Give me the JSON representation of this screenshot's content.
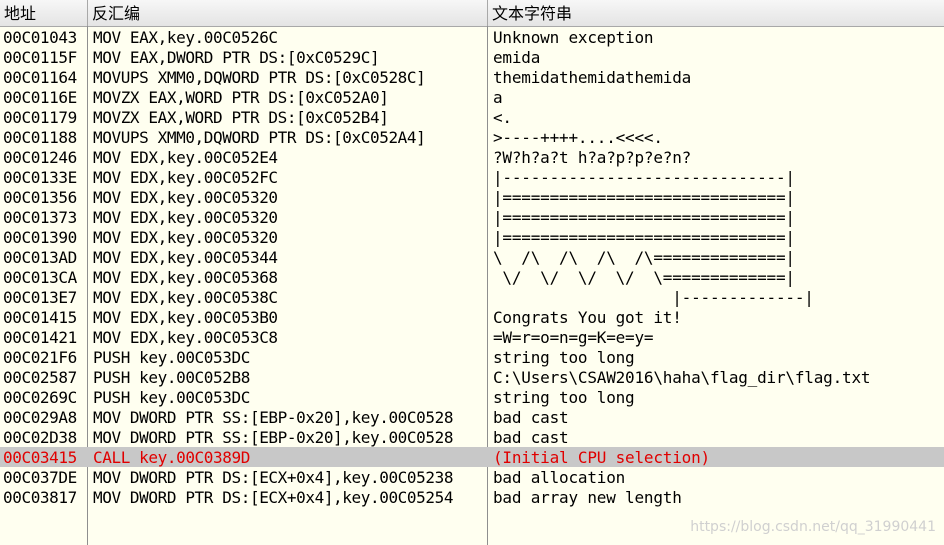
{
  "header": {
    "address": "地址",
    "disassembly": "反汇编",
    "text_string": "文本字符串"
  },
  "rows": [
    {
      "address": "00C01043",
      "disassembly": "MOV EAX,key.00C0526C",
      "text": "Unknown exception"
    },
    {
      "address": "00C0115F",
      "disassembly": "MOV EAX,DWORD PTR DS:[0xC0529C]",
      "text": "emida"
    },
    {
      "address": "00C01164",
      "disassembly": "MOVUPS XMM0,DQWORD PTR DS:[0xC0528C]",
      "text": "themidathemidathemida"
    },
    {
      "address": "00C0116E",
      "disassembly": "MOVZX EAX,WORD PTR DS:[0xC052A0]",
      "text": "a"
    },
    {
      "address": "00C01179",
      "disassembly": "MOVZX EAX,WORD PTR DS:[0xC052B4]",
      "text": "<."
    },
    {
      "address": "00C01188",
      "disassembly": "MOVUPS XMM0,DQWORD PTR DS:[0xC052A4]",
      "text": ">----++++....<<<<."
    },
    {
      "address": "00C01246",
      "disassembly": "MOV EDX,key.00C052E4",
      "text": "?W?h?a?t h?a?p?p?e?n?"
    },
    {
      "address": "00C0133E",
      "disassembly": "MOV EDX,key.00C052FC",
      "text": "|------------------------------|"
    },
    {
      "address": "00C01356",
      "disassembly": "MOV EDX,key.00C05320",
      "text": "|==============================|"
    },
    {
      "address": "00C01373",
      "disassembly": "MOV EDX,key.00C05320",
      "text": "|==============================|"
    },
    {
      "address": "00C01390",
      "disassembly": "MOV EDX,key.00C05320",
      "text": "|==============================|"
    },
    {
      "address": "00C013AD",
      "disassembly": "MOV EDX,key.00C05344",
      "text": "\\  /\\  /\\  /\\  /\\==============|"
    },
    {
      "address": "00C013CA",
      "disassembly": "MOV EDX,key.00C05368",
      "text": " \\/  \\/  \\/  \\/  \\=============|"
    },
    {
      "address": "00C013E7",
      "disassembly": "MOV EDX,key.00C0538C",
      "text": "                   |-------------|"
    },
    {
      "address": "00C01415",
      "disassembly": "MOV EDX,key.00C053B0",
      "text": "Congrats You got it!"
    },
    {
      "address": "00C01421",
      "disassembly": "MOV EDX,key.00C053C8",
      "text": "=W=r=o=n=g=K=e=y="
    },
    {
      "address": "00C021F6",
      "disassembly": "PUSH key.00C053DC",
      "text": "string too long"
    },
    {
      "address": "00C02587",
      "disassembly": "PUSH key.00C052B8",
      "text": "C:\\Users\\CSAW2016\\haha\\flag_dir\\flag.txt"
    },
    {
      "address": "00C0269C",
      "disassembly": "PUSH key.00C053DC",
      "text": "string too long"
    },
    {
      "address": "00C029A8",
      "disassembly": "MOV DWORD PTR SS:[EBP-0x20],key.00C0528",
      "text": "bad cast"
    },
    {
      "address": "00C02D38",
      "disassembly": "MOV DWORD PTR SS:[EBP-0x20],key.00C0528",
      "text": "bad cast"
    },
    {
      "address": "00C03415",
      "disassembly": "CALL key.00C0389D",
      "text": "(Initial CPU selection)",
      "selected": true
    },
    {
      "address": "00C037DE",
      "disassembly": "MOV DWORD PTR DS:[ECX+0x4],key.00C05238",
      "text": "bad allocation"
    },
    {
      "address": "00C03817",
      "disassembly": "MOV DWORD PTR DS:[ECX+0x4],key.00C05254",
      "text": "bad array new length"
    }
  ],
  "watermark": "https://blog.csdn.net/qq_31990441",
  "colors": {
    "background": "#fffff0",
    "selected_row": "#c8c8c8",
    "selected_text": "#e00000"
  }
}
